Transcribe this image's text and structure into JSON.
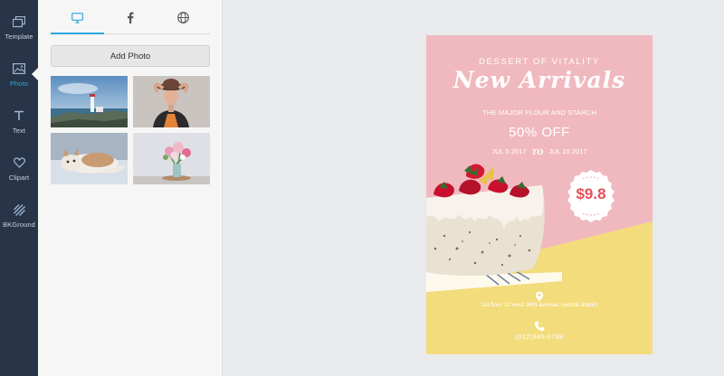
{
  "sidebar": {
    "items": [
      {
        "label": "Template",
        "icon": "template-icon",
        "active": false
      },
      {
        "label": "Photo",
        "icon": "photo-icon",
        "active": true
      },
      {
        "label": "Text",
        "icon": "text-icon",
        "active": false
      },
      {
        "label": "Clipart",
        "icon": "heart-icon",
        "active": false
      },
      {
        "label": "BKGround",
        "icon": "background-icon",
        "active": false
      }
    ]
  },
  "panel": {
    "tabs": [
      {
        "icon": "monitor-icon",
        "active": true
      },
      {
        "icon": "facebook-icon",
        "active": false
      },
      {
        "icon": "globe-icon",
        "active": false
      }
    ],
    "add_photo_label": "Add Photo",
    "photos": [
      "lighthouse-photo",
      "woman-hat-photo",
      "cat-photo",
      "flowers-photo"
    ]
  },
  "flyer": {
    "kicker": "DESSERT OF VITALITY",
    "title": "New Arrivals",
    "subtitle": "THE MAJOR FLOUR AND STARCH",
    "discount": "50% OFF",
    "date_start": "JUL 5 2017",
    "date_sep": "TO",
    "date_end": "JUL 15 2017",
    "price": "$9.8",
    "address": "1st floor 12 west 34th avenue, central district",
    "phone": "(012)345-6789"
  },
  "colors": {
    "rail_bg": "#283447",
    "accent": "#29a8e0",
    "flyer_pink": "#f0b9bf",
    "flyer_yellow": "#f3dc7c",
    "price_red": "#e4505a"
  }
}
